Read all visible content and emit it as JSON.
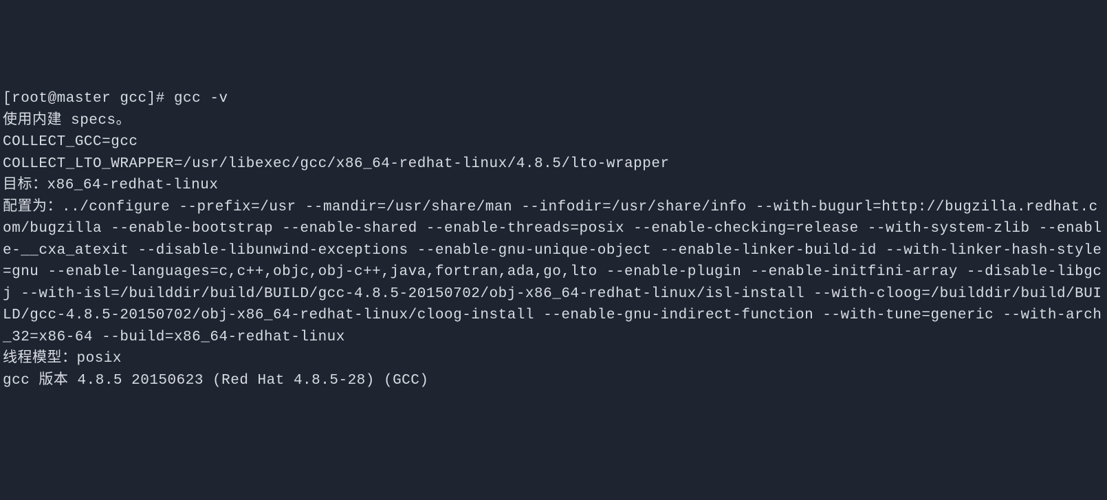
{
  "terminal": {
    "full_output": "[root@master gcc]# gcc -v\n使用内建 specs。\nCOLLECT_GCC=gcc\nCOLLECT_LTO_WRAPPER=/usr/libexec/gcc/x86_64-redhat-linux/4.8.5/lto-wrapper\n目标：x86_64-redhat-linux\n配置为：../configure --prefix=/usr --mandir=/usr/share/man --infodir=/usr/share/info --with-bugurl=http://bugzilla.redhat.com/bugzilla --enable-bootstrap --enable-shared --enable-threads=posix --enable-checking=release --with-system-zlib --enable-__cxa_atexit --disable-libunwind-exceptions --enable-gnu-unique-object --enable-linker-build-id --with-linker-hash-style=gnu --enable-languages=c,c++,objc,obj-c++,java,fortran,ada,go,lto --enable-plugin --enable-initfini-array --disable-libgcj --with-isl=/builddir/build/BUILD/gcc-4.8.5-20150702/obj-x86_64-redhat-linux/isl-install --with-cloog=/builddir/build/BUILD/gcc-4.8.5-20150702/obj-x86_64-redhat-linux/cloog-install --enable-gnu-indirect-function --with-tune=generic --with-arch_32=x86-64 --build=x86_64-redhat-linux\n线程模型：posix\ngcc 版本 4.8.5 20150623 (Red Hat 4.8.5-28) (GCC) ",
    "prompt": "[root@master gcc]#",
    "command": "gcc -v",
    "specs_line": "使用内建 specs。",
    "collect_gcc": "COLLECT_GCC=gcc",
    "collect_lto": "COLLECT_LTO_WRAPPER=/usr/libexec/gcc/x86_64-redhat-linux/4.8.5/lto-wrapper",
    "target": "目标：x86_64-redhat-linux",
    "thread_model": "线程模型：posix",
    "version": "gcc 版本 4.8.5 20150623 (Red Hat 4.8.5-28) (GCC)"
  }
}
